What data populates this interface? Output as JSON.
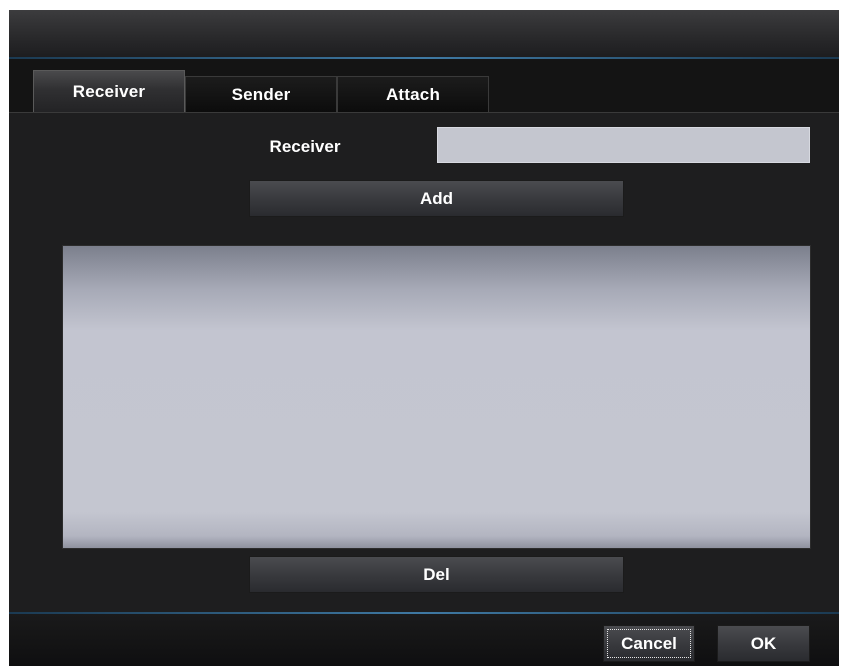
{
  "tabs": [
    {
      "label": "Receiver",
      "active": true
    },
    {
      "label": "Sender",
      "active": false
    },
    {
      "label": "Attach",
      "active": false
    }
  ],
  "receiver": {
    "label": "Receiver",
    "value": "",
    "placeholder": ""
  },
  "buttons": {
    "add": "Add",
    "del": "Del",
    "cancel": "Cancel",
    "ok": "OK"
  },
  "receiver_list": [],
  "colors": {
    "accent_line": "#3f79a3",
    "background": "#1e1e1f",
    "list_background": "#c4c6d0"
  }
}
